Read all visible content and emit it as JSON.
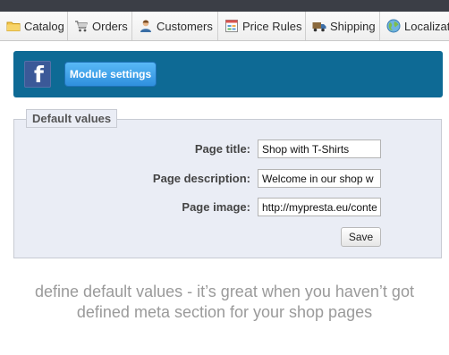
{
  "nav": {
    "tabs": [
      {
        "label": "Catalog",
        "icon": "folder-icon"
      },
      {
        "label": "Orders",
        "icon": "cart-icon"
      },
      {
        "label": "Customers",
        "icon": "customer-icon"
      },
      {
        "label": "Price Rules",
        "icon": "price-rules-icon"
      },
      {
        "label": "Shipping",
        "icon": "truck-icon"
      },
      {
        "label": "Localizati",
        "icon": "globe-icon"
      }
    ]
  },
  "module_bar": {
    "facebook_logo": "f",
    "module_settings_label": "Module settings"
  },
  "form": {
    "legend": "Default values",
    "page_title_label": "Page title:",
    "page_title_value": "Shop with T-Shirts",
    "page_description_label": "Page description:",
    "page_description_value": "Welcome in our shop w",
    "page_image_label": "Page image:",
    "page_image_value": "http://mypresta.eu/conte",
    "save_label": "Save"
  },
  "caption": {
    "line1": "define default values - it’s great when you haven’t got",
    "line2": "defined meta section for your shop pages"
  },
  "colors": {
    "module_bar": "#0e6a95",
    "button_blue": "#2f8fde",
    "panel_bg": "#eaedf5",
    "caption": "#9a9a9a"
  }
}
